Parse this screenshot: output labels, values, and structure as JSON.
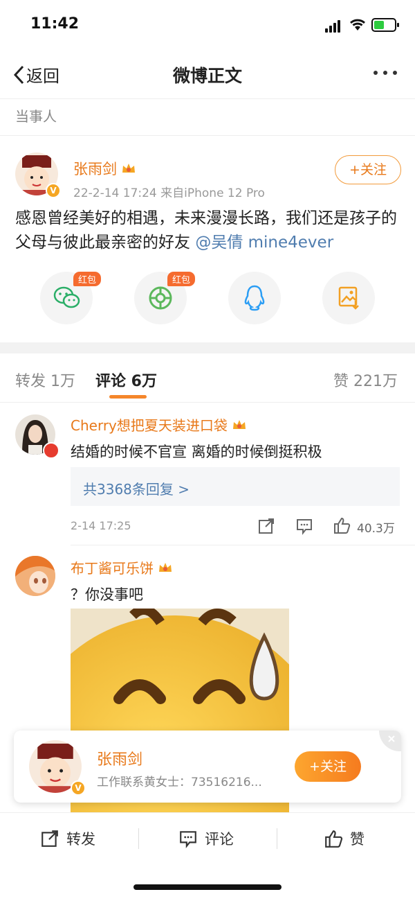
{
  "status": {
    "time": "11:42"
  },
  "nav": {
    "back_label": "返回",
    "title": "微博正文"
  },
  "section_label": "当事人",
  "post": {
    "author": "张雨剑",
    "meta": "22-2-14 17:24  来自iPhone 12 Pro",
    "follow_label": "+关注",
    "text": "感恩曾经美好的相遇，未来漫漫长路，我们还是孩子的父母与彼此最亲密的好友",
    "mention": "@吴倩",
    "tag": "mine4ever",
    "share": [
      {
        "icon": "wechat-icon",
        "tag": "红包"
      },
      {
        "icon": "moments-icon",
        "tag": "红包"
      },
      {
        "icon": "qq-icon",
        "tag": ""
      },
      {
        "icon": "save-image-icon",
        "tag": ""
      }
    ]
  },
  "tabs": {
    "repost": "转发 1万",
    "comment": "评论 6万",
    "like": "赞 221万"
  },
  "comments": [
    {
      "name": "Cherry想把夏天装进口袋",
      "text": "结婚的时候不官宣 离婚的时候倒挺积极",
      "replies": "共3368条回复 >",
      "time": "2-14 17:25",
      "likes": "40.3万"
    },
    {
      "name": "布丁酱可乐饼",
      "text": "？你没事吧"
    }
  ],
  "float_card": {
    "name": "张雨剑",
    "sub": "工作联系黄女士：73516216...",
    "follow_label": "+关注"
  },
  "bottom": {
    "repost": "转发",
    "comment": "评论",
    "like": "赞"
  },
  "colors": {
    "accent": "#e8791a",
    "link": "#507daf",
    "vip": "#f5a623"
  }
}
